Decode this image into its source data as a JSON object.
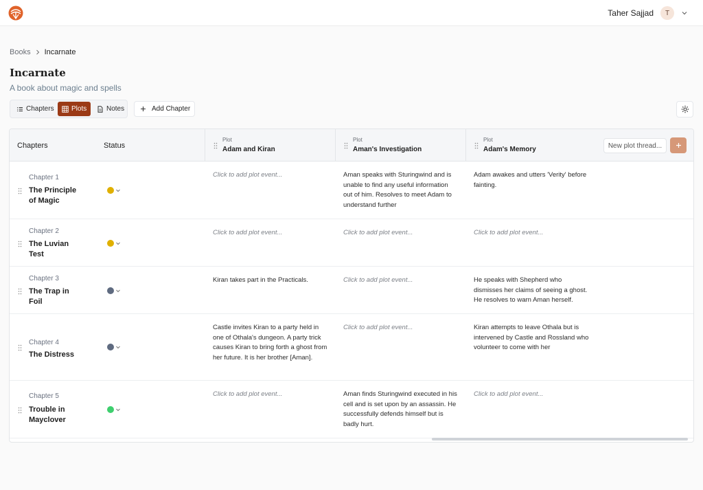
{
  "header": {
    "user_name": "Taher Sajjad",
    "avatar_initial": "T"
  },
  "breadcrumb": {
    "root": "Books",
    "current": "Incarnate"
  },
  "book": {
    "title": "Incarnate",
    "subtitle": "A book about magic and spells"
  },
  "view_tabs": {
    "chapters": "Chapters",
    "plots": "Plots",
    "notes": "Notes",
    "active": "Plots"
  },
  "add_chapter_label": "Add Chapter",
  "table": {
    "headers": {
      "chapters": "Chapters",
      "status": "Status"
    },
    "plot_kicker": "Plot",
    "plot_threads": [
      "Adam and Kiran",
      "Aman's Investigation",
      "Adam's Memory"
    ],
    "new_thread_placeholder": "New plot thread...",
    "empty_cell": "Click to add plot event..."
  },
  "rows": [
    {
      "kicker": "Chapter 1",
      "title": "The Principle of Magic",
      "status_color": "#e0b000",
      "cells": [
        "Click to add plot event...",
        "Aman speaks with Sturingwind and is unable to find any useful information out of him. Resolves to meet Adam to understand further",
        "Adam awakes and utters 'Verity' before fainting."
      ]
    },
    {
      "kicker": "Chapter 2",
      "title": "The Luvian Test",
      "status_color": "#e0b000",
      "cells": [
        "Click to add plot event...",
        "Click to add plot event...",
        "Click to add plot event..."
      ]
    },
    {
      "kicker": "Chapter 3",
      "title": "The Trap in Foil",
      "status_color": "#5f6b80",
      "cells": [
        "Kiran takes part in the Practicals.",
        "Click to add plot event...",
        "He speaks with Shepherd who dismisses her claims of seeing a ghost. He resolves to warn Aman herself."
      ]
    },
    {
      "kicker": "Chapter 4",
      "title": "The Distress",
      "status_color": "#5f6b80",
      "cells": [
        "Castle invites Kiran to a party held in one of Othala's dungeon. A party trick causes Kiran to bring forth a ghost from her future. It is her brother [Aman].",
        "Click to add plot event...",
        "Kiran attempts to leave Othala but is intervened by Castle and Rossland who volunteer to come with her"
      ]
    },
    {
      "kicker": "Chapter 5",
      "title": "Trouble in Mayclover",
      "status_color": "#3ecf6e",
      "cells": [
        "Click to add plot event...",
        "Aman finds Sturingwind executed in his cell and is set upon by an assassin. He successfully defends himself but is badly hurt.",
        "Click to add plot event..."
      ]
    }
  ]
}
